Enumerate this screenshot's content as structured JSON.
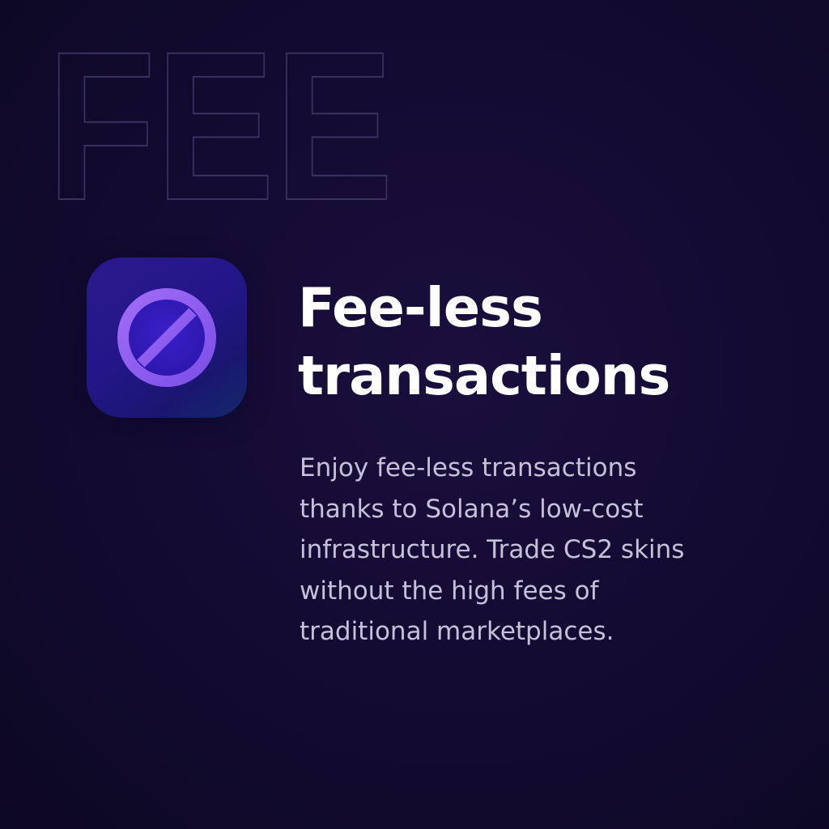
{
  "watermark": {
    "text": "FEE"
  },
  "icon": {
    "name": "no-fee-icon"
  },
  "heading": {
    "line1": "Fee-less",
    "line2": "transactions"
  },
  "description": {
    "lines": [
      "Enjoy fee-less transactions",
      "thanks to Solana’s low-cost",
      "infrastructure. Trade CS2 skins",
      "without the high fees of",
      "traditional marketplaces."
    ]
  },
  "colors": {
    "background": "#140b33",
    "icon_tile": "#24168a",
    "icon_ring": "#8c5cf0",
    "heading": "#ffffff",
    "body_text": "#c5c1d8"
  }
}
